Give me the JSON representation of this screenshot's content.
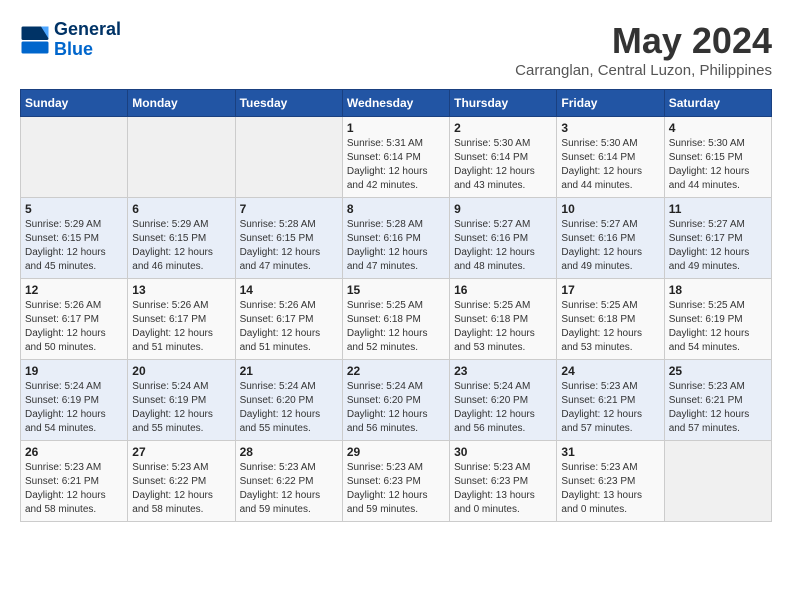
{
  "header": {
    "logo_line1": "General",
    "logo_line2": "Blue",
    "month": "May 2024",
    "location": "Carranglan, Central Luzon, Philippines"
  },
  "weekdays": [
    "Sunday",
    "Monday",
    "Tuesday",
    "Wednesday",
    "Thursday",
    "Friday",
    "Saturday"
  ],
  "weeks": [
    [
      {
        "day": "",
        "info": ""
      },
      {
        "day": "",
        "info": ""
      },
      {
        "day": "",
        "info": ""
      },
      {
        "day": "1",
        "info": "Sunrise: 5:31 AM\nSunset: 6:14 PM\nDaylight: 12 hours\nand 42 minutes."
      },
      {
        "day": "2",
        "info": "Sunrise: 5:30 AM\nSunset: 6:14 PM\nDaylight: 12 hours\nand 43 minutes."
      },
      {
        "day": "3",
        "info": "Sunrise: 5:30 AM\nSunset: 6:14 PM\nDaylight: 12 hours\nand 44 minutes."
      },
      {
        "day": "4",
        "info": "Sunrise: 5:30 AM\nSunset: 6:15 PM\nDaylight: 12 hours\nand 44 minutes."
      }
    ],
    [
      {
        "day": "5",
        "info": "Sunrise: 5:29 AM\nSunset: 6:15 PM\nDaylight: 12 hours\nand 45 minutes."
      },
      {
        "day": "6",
        "info": "Sunrise: 5:29 AM\nSunset: 6:15 PM\nDaylight: 12 hours\nand 46 minutes."
      },
      {
        "day": "7",
        "info": "Sunrise: 5:28 AM\nSunset: 6:15 PM\nDaylight: 12 hours\nand 47 minutes."
      },
      {
        "day": "8",
        "info": "Sunrise: 5:28 AM\nSunset: 6:16 PM\nDaylight: 12 hours\nand 47 minutes."
      },
      {
        "day": "9",
        "info": "Sunrise: 5:27 AM\nSunset: 6:16 PM\nDaylight: 12 hours\nand 48 minutes."
      },
      {
        "day": "10",
        "info": "Sunrise: 5:27 AM\nSunset: 6:16 PM\nDaylight: 12 hours\nand 49 minutes."
      },
      {
        "day": "11",
        "info": "Sunrise: 5:27 AM\nSunset: 6:17 PM\nDaylight: 12 hours\nand 49 minutes."
      }
    ],
    [
      {
        "day": "12",
        "info": "Sunrise: 5:26 AM\nSunset: 6:17 PM\nDaylight: 12 hours\nand 50 minutes."
      },
      {
        "day": "13",
        "info": "Sunrise: 5:26 AM\nSunset: 6:17 PM\nDaylight: 12 hours\nand 51 minutes."
      },
      {
        "day": "14",
        "info": "Sunrise: 5:26 AM\nSunset: 6:17 PM\nDaylight: 12 hours\nand 51 minutes."
      },
      {
        "day": "15",
        "info": "Sunrise: 5:25 AM\nSunset: 6:18 PM\nDaylight: 12 hours\nand 52 minutes."
      },
      {
        "day": "16",
        "info": "Sunrise: 5:25 AM\nSunset: 6:18 PM\nDaylight: 12 hours\nand 53 minutes."
      },
      {
        "day": "17",
        "info": "Sunrise: 5:25 AM\nSunset: 6:18 PM\nDaylight: 12 hours\nand 53 minutes."
      },
      {
        "day": "18",
        "info": "Sunrise: 5:25 AM\nSunset: 6:19 PM\nDaylight: 12 hours\nand 54 minutes."
      }
    ],
    [
      {
        "day": "19",
        "info": "Sunrise: 5:24 AM\nSunset: 6:19 PM\nDaylight: 12 hours\nand 54 minutes."
      },
      {
        "day": "20",
        "info": "Sunrise: 5:24 AM\nSunset: 6:19 PM\nDaylight: 12 hours\nand 55 minutes."
      },
      {
        "day": "21",
        "info": "Sunrise: 5:24 AM\nSunset: 6:20 PM\nDaylight: 12 hours\nand 55 minutes."
      },
      {
        "day": "22",
        "info": "Sunrise: 5:24 AM\nSunset: 6:20 PM\nDaylight: 12 hours\nand 56 minutes."
      },
      {
        "day": "23",
        "info": "Sunrise: 5:24 AM\nSunset: 6:20 PM\nDaylight: 12 hours\nand 56 minutes."
      },
      {
        "day": "24",
        "info": "Sunrise: 5:23 AM\nSunset: 6:21 PM\nDaylight: 12 hours\nand 57 minutes."
      },
      {
        "day": "25",
        "info": "Sunrise: 5:23 AM\nSunset: 6:21 PM\nDaylight: 12 hours\nand 57 minutes."
      }
    ],
    [
      {
        "day": "26",
        "info": "Sunrise: 5:23 AM\nSunset: 6:21 PM\nDaylight: 12 hours\nand 58 minutes."
      },
      {
        "day": "27",
        "info": "Sunrise: 5:23 AM\nSunset: 6:22 PM\nDaylight: 12 hours\nand 58 minutes."
      },
      {
        "day": "28",
        "info": "Sunrise: 5:23 AM\nSunset: 6:22 PM\nDaylight: 12 hours\nand 59 minutes."
      },
      {
        "day": "29",
        "info": "Sunrise: 5:23 AM\nSunset: 6:23 PM\nDaylight: 12 hours\nand 59 minutes."
      },
      {
        "day": "30",
        "info": "Sunrise: 5:23 AM\nSunset: 6:23 PM\nDaylight: 13 hours\nand 0 minutes."
      },
      {
        "day": "31",
        "info": "Sunrise: 5:23 AM\nSunset: 6:23 PM\nDaylight: 13 hours\nand 0 minutes."
      },
      {
        "day": "",
        "info": ""
      }
    ]
  ]
}
